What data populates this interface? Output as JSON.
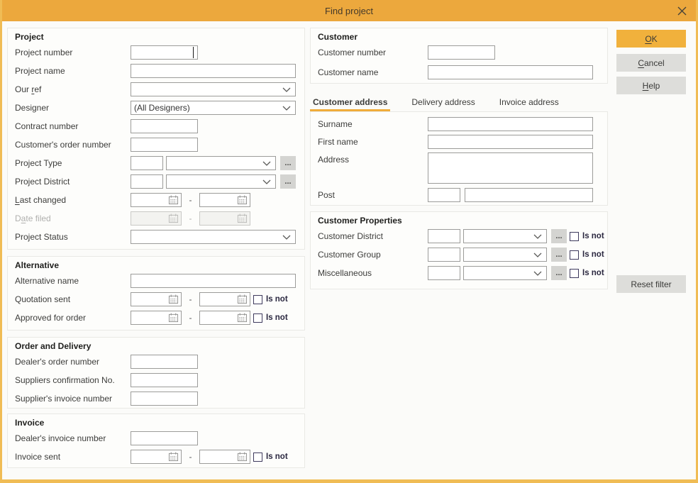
{
  "window": {
    "title": "Find project"
  },
  "common": {
    "range_separator": "-",
    "dots": "...",
    "is_not": "Is not"
  },
  "colors": {
    "accent": "#ECA83D",
    "frame": "#F0BC55",
    "tab_underline": "#F0AC3A",
    "checkbox": "#3E3A5D"
  },
  "buttons": {
    "ok": {
      "pre": "",
      "accel": "O",
      "post": "K"
    },
    "cancel": {
      "pre": "",
      "accel": "C",
      "post": "ancel"
    },
    "help": {
      "pre": "",
      "accel": "H",
      "post": "elp"
    },
    "reset_filter": "Reset filter"
  },
  "project": {
    "header": "Project",
    "project_number": "Project number",
    "project_name": "Project name",
    "our_ref": {
      "pre": "Our ",
      "accel": "r",
      "post": "ef"
    },
    "designer": "Designer",
    "designer_value": "(All Designers)",
    "contract_number": "Contract number",
    "customers_order_number": "Customer's order number",
    "project_type": "Project Type",
    "project_district": "Project District",
    "last_changed": {
      "pre": "",
      "accel": "L",
      "post": "ast changed"
    },
    "date_filed": {
      "pre": "D",
      "accel": "a",
      "post": "te filed"
    },
    "project_status": "Project Status"
  },
  "alternative": {
    "header": "Alternative",
    "alternative_name": "Alternative name",
    "quotation_sent": "Quotation sent",
    "approved_for_order": "Approved for order"
  },
  "order_delivery": {
    "header": "Order and Delivery",
    "dealers_order_number": "Dealer's order number",
    "suppliers_confirmation_no": "Suppliers confirmation No.",
    "suppliers_invoice_number": "Supplier's invoice number"
  },
  "invoice": {
    "header": "Invoice",
    "dealers_invoice_number": "Dealer's invoice number",
    "invoice_sent": "Invoice sent"
  },
  "customer": {
    "header": "Customer",
    "customer_number": "Customer number",
    "customer_name": "Customer name"
  },
  "address_tabs": {
    "customer_address": "Customer address",
    "delivery_address": "Delivery address",
    "invoice_address": "Invoice address"
  },
  "address": {
    "surname": "Surname",
    "first_name": "First name",
    "address": "Address",
    "post": "Post"
  },
  "customer_properties": {
    "header": "Customer Properties",
    "customer_district": "Customer District",
    "customer_group": "Customer Group",
    "miscellaneous": "Miscellaneous"
  }
}
